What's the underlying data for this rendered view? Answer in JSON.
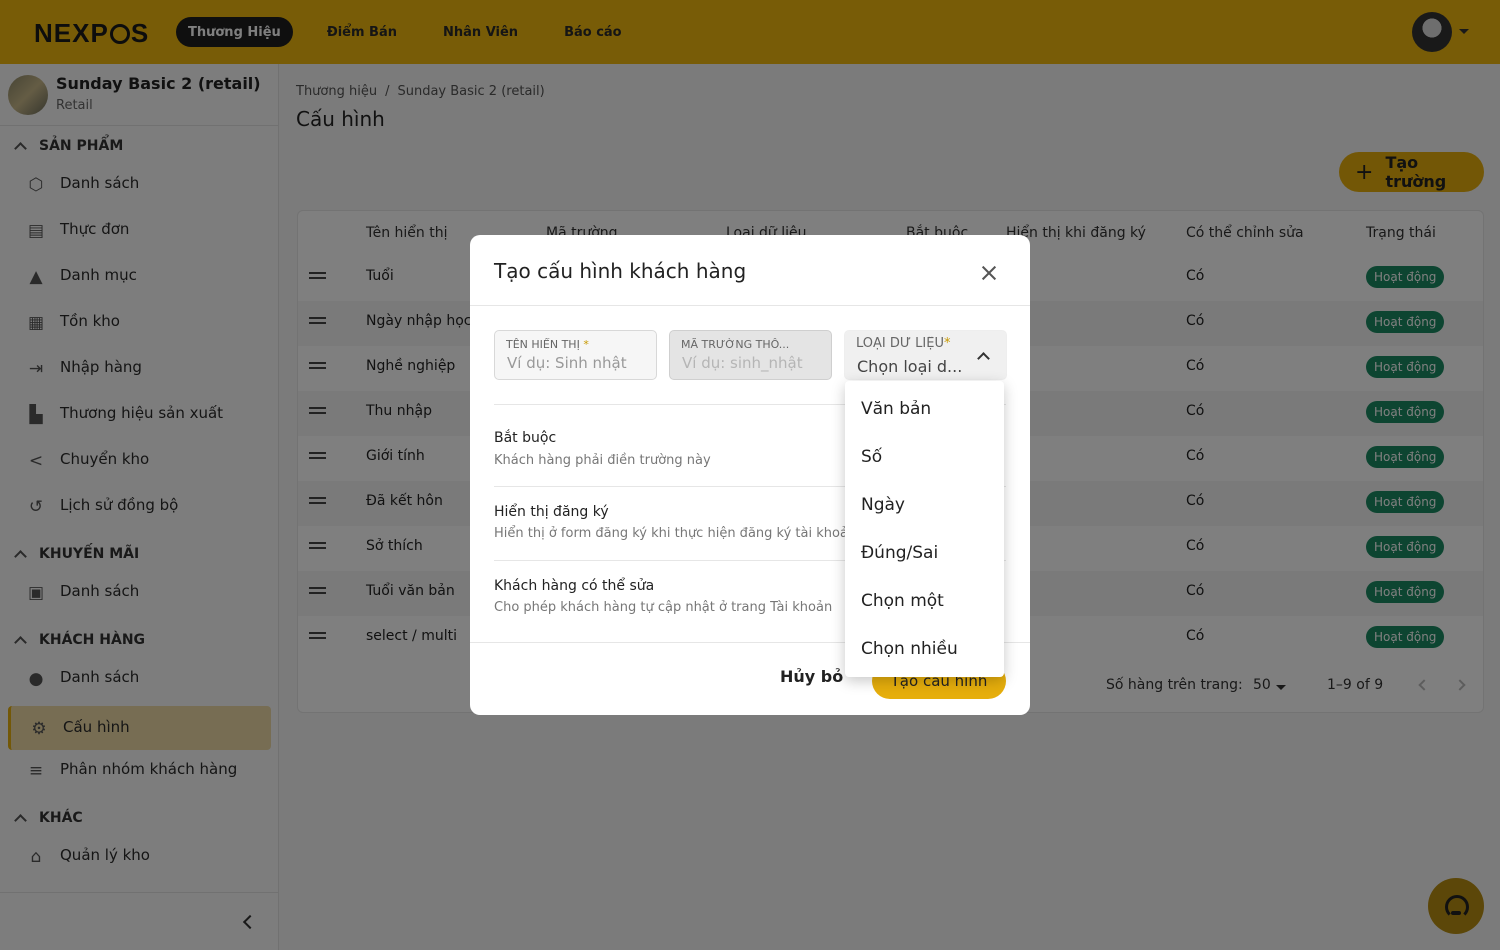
{
  "header": {
    "logo": "NEXPOS",
    "nav": [
      "Thương Hiệu",
      "Điểm Bán",
      "Nhân Viên",
      "Báo cáo"
    ]
  },
  "sidebar": {
    "store_name": "Sunday Basic 2 (retail)",
    "store_type": "Retail",
    "sections": {
      "products": "SẢN PHẨM",
      "promotions": "KHUYẾN MÃI",
      "customers": "KHÁCH HÀNG",
      "other": "KHÁC"
    },
    "items": {
      "p_list": "Danh sách",
      "menu": "Thực đơn",
      "category": "Danh mục",
      "stock": "Tồn kho",
      "import": "Nhập hàng",
      "brand": "Thương hiệu sản xuất",
      "transfer": "Chuyển kho",
      "sync": "Lịch sử đồng bộ",
      "promo_list": "Danh sách",
      "cust_list": "Danh sách",
      "config": "Cấu hình",
      "segments": "Phân nhóm khách hàng",
      "warehouse": "Quản lý kho"
    }
  },
  "breadcrumb": {
    "root": "Thương hiệu",
    "sep": "/",
    "store": "Sunday Basic 2 (retail)"
  },
  "page_title": "Cấu hình",
  "create_field_label": "Tạo trường",
  "table": {
    "headers": [
      "Tên hiển thị",
      "Mã trường",
      "Loại dữ liệu",
      "Bắt buộc",
      "Hiển thị khi đăng ký",
      "Có thể chỉnh sửa",
      "Trạng thái"
    ],
    "rows": [
      {
        "name": "Tuổi",
        "editable": "Có",
        "status": "Hoạt động"
      },
      {
        "name": "Ngày nhập học",
        "editable": "Có",
        "status": "Hoạt động"
      },
      {
        "name": "Nghề nghiệp",
        "editable": "Có",
        "status": "Hoạt động"
      },
      {
        "name": "Thu nhập",
        "editable": "Có",
        "status": "Hoạt động"
      },
      {
        "name": "Giới tính",
        "editable": "Có",
        "status": "Hoạt động"
      },
      {
        "name": "Đã kết hôn",
        "editable": "Có",
        "status": "Hoạt động"
      },
      {
        "name": "Sở thích",
        "editable": "Có",
        "status": "Hoạt động"
      },
      {
        "name": "Tuổi văn bản",
        "editable": "Có",
        "status": "Hoạt động"
      },
      {
        "name": "select / multi",
        "editable": "Có",
        "status": "Hoạt động"
      }
    ],
    "rows_per_page_label": "Số hàng trên trang:",
    "rows_per_page": "50",
    "range": "1–9 of 9"
  },
  "dialog": {
    "title": "Tạo cấu hình khách hàng",
    "display_name": {
      "label": "TÊN HIỂN THỊ",
      "required": "*",
      "placeholder": "Ví dụ: Sinh nhật"
    },
    "field_code": {
      "label": "MÃ TRƯỜNG THÔ...",
      "placeholder": "Ví dụ: sinh_nhật"
    },
    "data_type": {
      "label": "LOẠI DỮ LIỆU",
      "required": "*",
      "value": "Chọn loại d..."
    },
    "options": {
      "required_title": "Bắt buộc",
      "required_desc": "Khách hàng phải điền trường này",
      "register_title": "Hiển thị đăng ký",
      "register_desc": "Hiển thị ở form đăng ký khi thực hiện đăng ký tài khoản",
      "editable_title": "Khách hàng có thể sửa",
      "editable_desc": "Cho phép khách hàng tự cập nhật ở trang Tài khoản"
    },
    "cancel": "Hủy bỏ",
    "create": "Tạo cấu hình"
  },
  "dropdown": [
    "Văn bản",
    "Số",
    "Ngày",
    "Đúng/Sai",
    "Chọn một",
    "Chọn nhiều"
  ]
}
